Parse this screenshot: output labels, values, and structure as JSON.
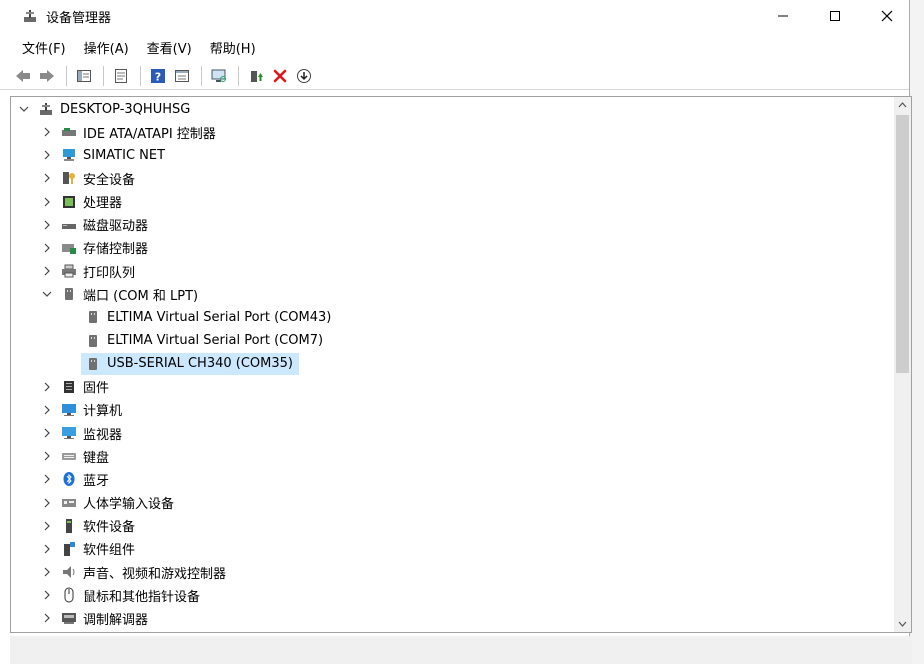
{
  "window": {
    "title": "设备管理器"
  },
  "menu": [
    {
      "label": "文件(F)"
    },
    {
      "label": "操作(A)"
    },
    {
      "label": "查看(V)"
    },
    {
      "label": "帮助(H)"
    }
  ],
  "toolbar": [
    {
      "icon": "back-arrow-icon"
    },
    {
      "icon": "forward-arrow-icon"
    },
    {
      "icon": "show-hide-tree-icon"
    },
    {
      "icon": "properties-icon"
    },
    {
      "icon": "help-icon"
    },
    {
      "icon": "action-pane-icon"
    },
    {
      "icon": "scan-hardware-icon"
    },
    {
      "icon": "update-driver-icon"
    },
    {
      "icon": "uninstall-x-icon"
    },
    {
      "icon": "download-arrow-icon"
    }
  ],
  "tree": {
    "root": "DESKTOP-3QHUHSG",
    "categories": [
      {
        "label": "IDE ATA/ATAPI 控制器",
        "icon": "ide-controller-icon"
      },
      {
        "label": "SIMATIC NET",
        "icon": "network-icon"
      },
      {
        "label": "安全设备",
        "icon": "security-key-icon"
      },
      {
        "label": "处理器",
        "icon": "processor-icon"
      },
      {
        "label": "磁盘驱动器",
        "icon": "disk-drive-icon"
      },
      {
        "label": "存储控制器",
        "icon": "storage-controller-icon"
      },
      {
        "label": "打印队列",
        "icon": "printer-icon"
      },
      {
        "label": "端口 (COM 和 LPT)",
        "icon": "port-icon",
        "expanded": true,
        "children": [
          {
            "label": "ELTIMA Virtual Serial Port (COM43)"
          },
          {
            "label": "ELTIMA Virtual Serial Port (COM7)"
          },
          {
            "label": "USB-SERIAL CH340 (COM35)",
            "selected": true
          }
        ]
      },
      {
        "label": "固件",
        "icon": "firmware-icon"
      },
      {
        "label": "计算机",
        "icon": "computer-icon"
      },
      {
        "label": "监视器",
        "icon": "monitor-icon"
      },
      {
        "label": "键盘",
        "icon": "keyboard-icon"
      },
      {
        "label": "蓝牙",
        "icon": "bluetooth-icon"
      },
      {
        "label": "人体学输入设备",
        "icon": "hid-icon"
      },
      {
        "label": "软件设备",
        "icon": "software-device-icon"
      },
      {
        "label": "软件组件",
        "icon": "software-component-icon"
      },
      {
        "label": "声音、视频和游戏控制器",
        "icon": "speaker-icon"
      },
      {
        "label": "鼠标和其他指针设备",
        "icon": "mouse-icon"
      },
      {
        "label": "调制解调器",
        "icon": "modem-icon"
      }
    ]
  }
}
